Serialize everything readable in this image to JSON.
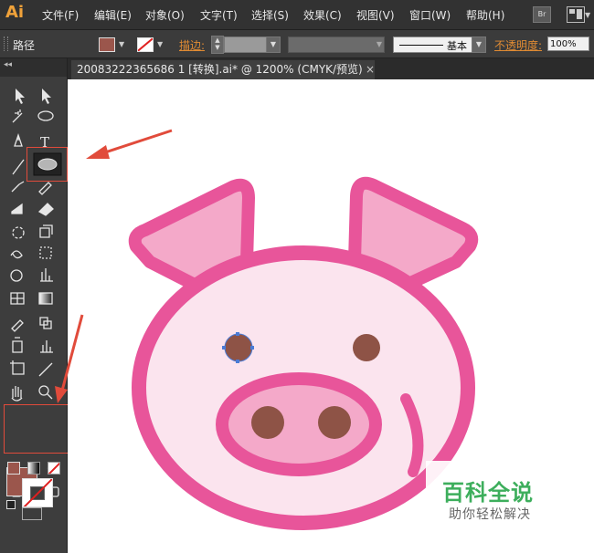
{
  "app": {
    "logo": "Ai"
  },
  "menu": [
    {
      "label": "文件(F)"
    },
    {
      "label": "编辑(E)"
    },
    {
      "label": "对象(O)"
    },
    {
      "label": "文字(T)"
    },
    {
      "label": "选择(S)"
    },
    {
      "label": "效果(C)"
    },
    {
      "label": "视图(V)"
    },
    {
      "label": "窗口(W)"
    },
    {
      "label": "帮助(H)"
    }
  ],
  "bridge_label": "Br",
  "control_bar": {
    "selection_type": "路径",
    "fill_color": "#9b564c",
    "stroke_label": "描边:",
    "brush_label": "基本",
    "opacity_label": "不透明度:",
    "opacity_value": "100%"
  },
  "document_tab": {
    "title": "20083222365686 1 [转换].ai* @ 1200% (CMYK/预览)",
    "close_glyph": "×"
  },
  "toolbox": {
    "collapse_glyph": "◂◂",
    "active_tool": "ellipse-tool",
    "fill_color": "#9b564c",
    "swap_glyph": "↰"
  },
  "watermark": {
    "title": "百科全说",
    "subtitle": "助你轻松解决"
  },
  "colors": {
    "pig_outline": "#e8559a",
    "pig_face": "#fbe4ee",
    "pig_ear_inner": "#f4a9c9",
    "pig_dots": "#8e5346",
    "annotation": "#e14b3b",
    "accent": "#f0a23a"
  }
}
